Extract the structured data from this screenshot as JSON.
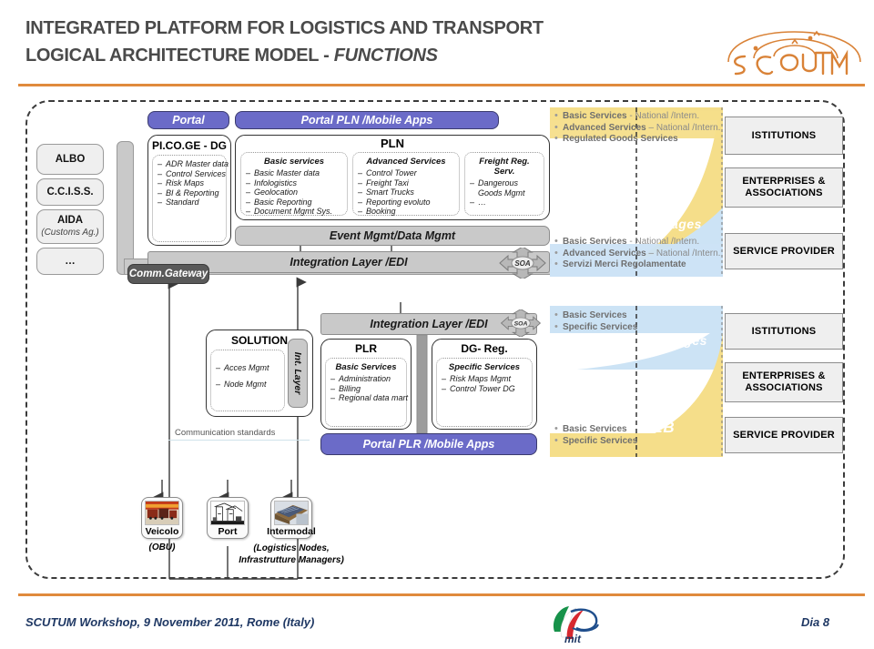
{
  "header": {
    "title_line1": "INTEGRATED PLATFORM FOR LOGISTICS AND TRANSPORT",
    "title_line2_normal": "LOGICAL ARCHITECTURE MODEL - ",
    "title_line2_italic": "FUNCTIONS",
    "logo_text": "SCUTUM",
    "accent_color": "#E08A3C"
  },
  "footer": {
    "text": "SCUTUM Workshop, 9 November 2011, Rome (Italy)",
    "slide_number": "Dia 8",
    "logo_text": "mit",
    "color": "#1F3864"
  },
  "left_actors": [
    {
      "label": "ALBO",
      "sub": ""
    },
    {
      "label": "C.C.I.S.S.",
      "sub": ""
    },
    {
      "label": "AIDA",
      "sub": "(Customs Ag.)"
    },
    {
      "label": "…",
      "sub": ""
    }
  ],
  "gateway": {
    "label": "Comm.Gateway"
  },
  "upper": {
    "portal_bar": "Portal",
    "portal_pln_bar": "Portal PLN /Mobile Apps",
    "picoge": {
      "title": "PI.CO.GE - DG",
      "items": [
        "ADR Master data",
        "Control Services",
        "Risk Maps",
        "BI & Reporting",
        "Standard"
      ]
    },
    "pln": {
      "title": "PLN",
      "groups": [
        {
          "title": "Basic services",
          "items": [
            "Basic Master data",
            "Infologistics",
            "Geolocation",
            "Basic Reporting",
            "Document Mgmt Sys."
          ]
        },
        {
          "title": "Advanced Services",
          "items": [
            "Control Tower",
            "Freight Taxi",
            "Smart Trucks",
            "Reporting evoluto",
            "Booking"
          ]
        },
        {
          "title": "Freight Reg. Serv.",
          "items": [
            "Dangerous Goods Mgmt",
            "…"
          ]
        }
      ]
    },
    "event_mgmt_bar": "Event Mgmt/Data Mgmt",
    "integration_bar": "Integration Layer /EDI",
    "soa_badge": "SOA"
  },
  "lower": {
    "solution": {
      "title": "SOLUTION",
      "items": [
        "Acces Mgmt",
        "Node Mgmt"
      ]
    },
    "int_layer_bar": "Int. Layer",
    "integration_bar": "Integration Layer /EDI",
    "soa_badge": "SOA",
    "plr": {
      "title": "PLR",
      "group_title": "Basic Services",
      "items": [
        "Administration",
        "Billing",
        "Regional data mart"
      ]
    },
    "dg_reg": {
      "title": "DG- Reg.",
      "group_title": "Specific Services",
      "items": [
        "Risk Maps Mgmt",
        "Control Tower  DG"
      ]
    },
    "portal_plr_bar": "Portal PLR /Mobile Apps",
    "communication_standards": "Communication standards"
  },
  "channels": {
    "web_label": "WEB",
    "messages_label": "Messages",
    "web_color": "#F5DE8A",
    "messages_color": "#CCE3F5",
    "upper_web_services": [
      {
        "bold": "Basic Services",
        "rest": "  - National /Intern."
      },
      {
        "bold": "Advanced Services",
        "rest": " – National /Intern."
      },
      {
        "bold": "Regulated Goods Services",
        "rest": ""
      }
    ],
    "upper_msg_services": [
      {
        "bold": "Basic Services",
        "rest": "  - National /Intern."
      },
      {
        "bold": "Advanced Services",
        "rest": " – National /Intern."
      },
      {
        "bold": "Servizi Merci Regolamentate",
        "rest": ""
      }
    ],
    "lower_msg_services": [
      {
        "bold": "Basic Services",
        "rest": ""
      },
      {
        "bold": "Specific Services",
        "rest": ""
      }
    ],
    "lower_web_services": [
      {
        "bold": "Basic Services",
        "rest": ""
      },
      {
        "bold": "Specific Services",
        "rest": ""
      }
    ]
  },
  "stakeholders_upper": [
    "ISTITUTIONS",
    "ENTERPRISES & ASSOCIATIONS",
    "SERVICE PROVIDER"
  ],
  "stakeholders_lower": [
    "ISTITUTIONS",
    "ENTERPRISES & ASSOCIATIONS",
    "SERVICE PROVIDER"
  ],
  "devices": [
    {
      "label": "Veicolo",
      "sub": "(OBU)",
      "icon": "truck-photo-icon"
    },
    {
      "label": "Port",
      "sub": "",
      "icon": "port-crane-photo-icon"
    },
    {
      "label": "Intermodal",
      "sub": "",
      "icon": "intermodal-photo-icon"
    }
  ],
  "devices_caption_line1": "(Logistics Nodes,",
  "devices_caption_line2": "Infrastrutture Managers)"
}
